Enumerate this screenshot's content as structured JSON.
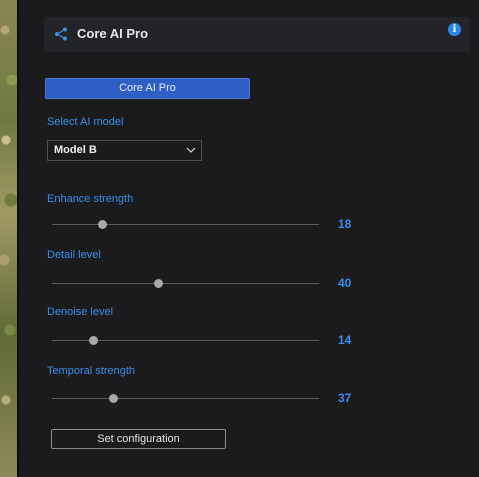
{
  "header": {
    "title": "Core AI Pro",
    "share_icon": "share-icon",
    "info_icon": "info-icon",
    "info_glyph": "i"
  },
  "primary_button": {
    "label": "Core AI Pro"
  },
  "model_select": {
    "label": "Select AI model",
    "value": "Model B",
    "icon": "chevron-down-icon"
  },
  "sliders": [
    {
      "label": "Enhance strength",
      "value": "18",
      "fraction": 0.19
    },
    {
      "label": "Detail level",
      "value": "40",
      "fraction": 0.4
    },
    {
      "label": "Denoise level",
      "value": "14",
      "fraction": 0.155
    },
    {
      "label": "Temporal strength",
      "value": "37",
      "fraction": 0.23
    }
  ],
  "secondary_button": {
    "label": "Set configuration"
  },
  "colors": {
    "accent": "#3d8ee8",
    "button": "#2d5fc4",
    "background": "#1b1b1d",
    "header": "#232427"
  }
}
